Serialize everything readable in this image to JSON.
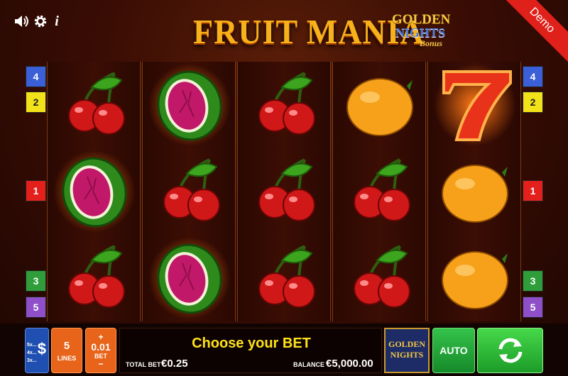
{
  "header": {
    "title": "FRUIT MANIA",
    "logo": {
      "line1": "GOLDEN",
      "line2": "NIGHTS",
      "line3": "Bonus"
    },
    "ribbon": "Demo",
    "controls": {
      "sound_icon": "speaker-icon",
      "settings_icon": "gear-icon",
      "info_label": "i"
    }
  },
  "reels": [
    [
      "cherry",
      "watermelon",
      "cherry"
    ],
    [
      "watermelon",
      "cherry",
      "watermelon"
    ],
    [
      "cherry",
      "cherry",
      "cherry"
    ],
    [
      "orange",
      "cherry",
      "cherry"
    ],
    [
      "seven",
      "orange",
      "orange"
    ]
  ],
  "paylines": {
    "left": [
      {
        "num": "4",
        "color": "#3b5fd6"
      },
      {
        "num": "2",
        "color": "#f1e21a"
      },
      {
        "num": "1",
        "color": "#e3201b"
      },
      {
        "num": "3",
        "color": "#2f9e3a"
      },
      {
        "num": "5",
        "color": "#8e4fc8"
      }
    ],
    "right": [
      {
        "num": "4",
        "color": "#3b5fd6"
      },
      {
        "num": "2",
        "color": "#f1e21a"
      },
      {
        "num": "1",
        "color": "#e3201b"
      },
      {
        "num": "3",
        "color": "#2f9e3a"
      },
      {
        "num": "5",
        "color": "#8e4fc8"
      }
    ]
  },
  "bottom": {
    "paytable": {
      "rows": [
        "5x...",
        "4x...",
        "3x..."
      ],
      "symbol": "$"
    },
    "lines": {
      "value": "5",
      "label": "LINES"
    },
    "bet": {
      "plus": "+",
      "value": "0.01",
      "label": "BET",
      "minus": "−"
    },
    "message": "Choose your BET",
    "total_bet": {
      "label": "TOTAL BET",
      "value": "€0.25"
    },
    "balance": {
      "label": "BALANCE",
      "value": "€5,000.00"
    },
    "golden_nights": {
      "line1": "GOLDEN",
      "line2": "NIGHTS"
    },
    "auto_label": "AUTO",
    "spin_icon": "spin-arrows-icon"
  },
  "colors": {
    "title": "#f7b21b",
    "auto": "#21a83a",
    "spin": "#2fc43a",
    "lines": "#e8641a",
    "message": "#ffe21a"
  }
}
